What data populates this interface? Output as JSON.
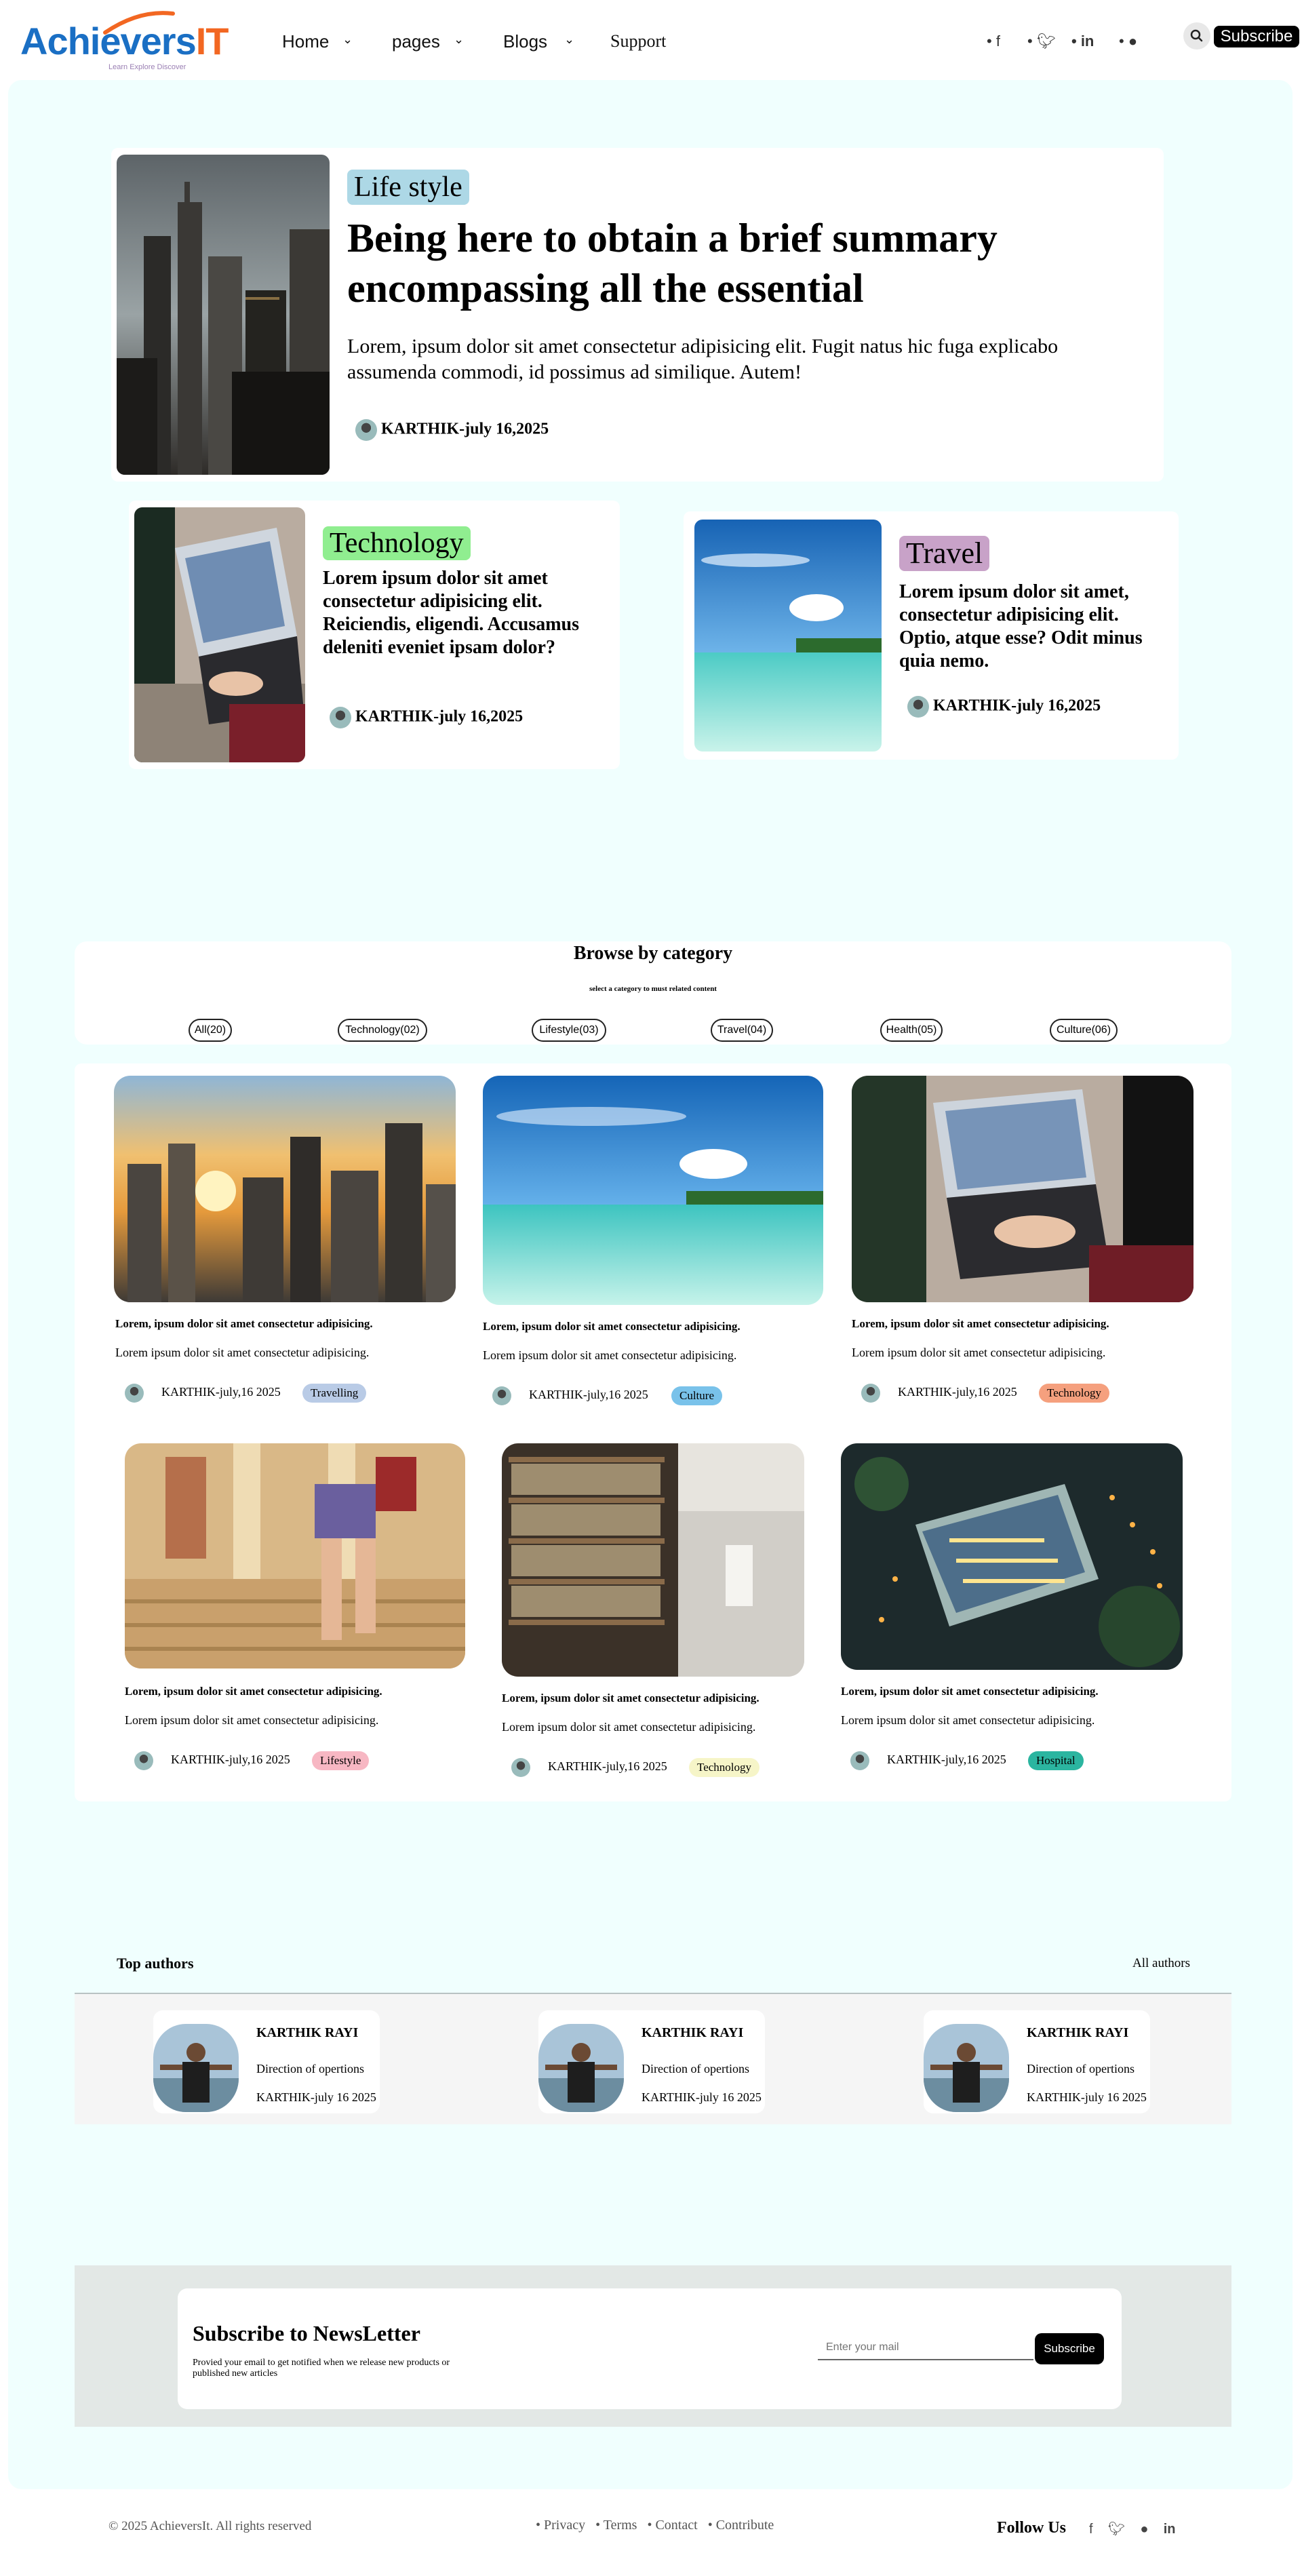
{
  "brand": {
    "logo_part1": "Achie",
    "logo_part2": "vers",
    "logo_part3": "IT",
    "tagline": "Learn Explore Discover"
  },
  "nav": {
    "items": [
      {
        "label": "Home"
      },
      {
        "label": "pages"
      },
      {
        "label": "Blogs"
      },
      {
        "label": "Support"
      }
    ],
    "social_icons": [
      "facebook-icon",
      "twitter-icon",
      "linkedin-icon",
      "reddit-icon"
    ],
    "subscribe_label": "Subscribe"
  },
  "hero": {
    "category": "Life style",
    "title": "Being here to obtain a brief summary encompassing all the essential",
    "excerpt": "Lorem, ipsum dolor sit amet consectetur adipisicing elit. Fugit natus hic fuga explicabo assumenda commodi, id possimus ad similique. Autem!",
    "author": "KARTHIK-july 16,2025"
  },
  "featured": [
    {
      "category": "Technology",
      "title": "Lorem ipsum dolor sit amet consectetur adipisicing elit. Reiciendis, eligendi. Accusamus deleniti eveniet ipsam dolor?",
      "author": "KARTHIK-july 16,2025"
    },
    {
      "category": "Travel",
      "title": "Lorem ipsum dolor sit amet, consectetur adipisicing elit. Optio, atque esse? Odit minus quia nemo.",
      "author": "KARTHIK-july 16,2025"
    }
  ],
  "browse": {
    "title": "Browse by category",
    "subtitle": "select a category to must related content",
    "categories": [
      {
        "label": "All(20)"
      },
      {
        "label": "Technology(02)"
      },
      {
        "label": "Lifestyle(03)"
      },
      {
        "label": "Travel(04)"
      },
      {
        "label": "Health(05)"
      },
      {
        "label": "Culture(06)"
      }
    ]
  },
  "posts": [
    {
      "title": "Lorem, ipsum dolor sit amet consectetur adipisicing.",
      "excerpt": "Lorem ipsum dolor sit amet consectetur adipisicing.",
      "author": "KARTHIK-july,16 2025",
      "tag": "Travelling",
      "tag_color": "#b9cbe6"
    },
    {
      "title": "Lorem, ipsum dolor sit amet consectetur adipisicing.",
      "excerpt": "Lorem ipsum dolor sit amet consectetur adipisicing.",
      "author": "KARTHIK-july,16 2025",
      "tag": "Culture",
      "tag_color": "#79c2ea"
    },
    {
      "title": "Lorem, ipsum dolor sit amet consectetur adipisicing.",
      "excerpt": "Lorem ipsum dolor sit amet consectetur adipisicing.",
      "author": "KARTHIK-july,16 2025",
      "tag": "Technology",
      "tag_color": "#f5a07e"
    },
    {
      "title": "Lorem, ipsum dolor sit amet consectetur adipisicing.",
      "excerpt": "Lorem ipsum dolor sit amet consectetur adipisicing.",
      "author": "KARTHIK-july,16 2025",
      "tag": "Lifestyle",
      "tag_color": "#f7b7c3"
    },
    {
      "title": "Lorem, ipsum dolor sit amet consectetur adipisicing.",
      "excerpt": "Lorem ipsum dolor sit amet consectetur adipisicing.",
      "author": "KARTHIK-july,16 2025",
      "tag": "Technology",
      "tag_color": "#f6f5c8"
    },
    {
      "title": "Lorem, ipsum dolor sit amet consectetur adipisicing.",
      "excerpt": "Lorem ipsum dolor sit amet consectetur adipisicing.",
      "author": "KARTHIK-july,16 2025",
      "tag": "Hospital",
      "tag_color": "#2bb5a0"
    }
  ],
  "authors": {
    "heading": "Top authors",
    "all_link": "All authors",
    "items": [
      {
        "name": "KARTHIK RAYI",
        "role": "Direction of opertions",
        "date": "KARTHIK-july 16 2025"
      },
      {
        "name": "KARTHIK RAYI",
        "role": "Direction of opertions",
        "date": "KARTHIK-july 16 2025"
      },
      {
        "name": "KARTHIK RAYI",
        "role": "Direction of opertions",
        "date": "KARTHIK-july 16 2025"
      }
    ]
  },
  "newsletter": {
    "title": "Subscribe to NewsLetter",
    "description": "Provied your email to get notified when we release new products or published new articles",
    "placeholder": "Enter your mail",
    "button": "Subscribe"
  },
  "footer": {
    "copyright": "© 2025 AchieversIt. All rights reserved",
    "links": [
      {
        "label": "Privacy"
      },
      {
        "label": "Terms"
      },
      {
        "label": "Contact"
      },
      {
        "label": "Contribute"
      }
    ],
    "follow": "Follow Us"
  },
  "colors": {
    "page_bg": "#f0fffe",
    "hero_badge": "#add8e6",
    "tech_badge": "#90ee90",
    "travel_badge": "#c8a2c8",
    "logo_blue": "#1a6fc4",
    "logo_orange": "#f26722"
  }
}
